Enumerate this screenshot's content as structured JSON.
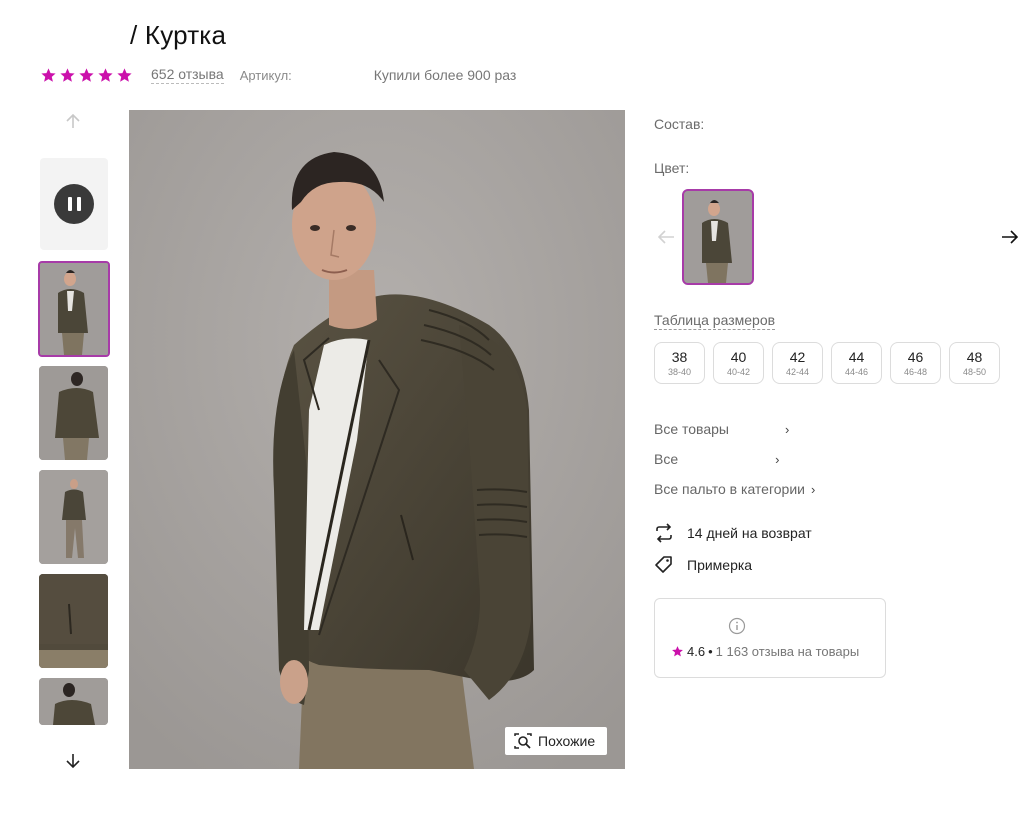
{
  "product": {
    "title": "/ Куртка",
    "reviews_link": "652 отзыва",
    "article_label": "Артикул:",
    "bought_text": "Купили более 900 раз",
    "rating_stars": 5,
    "accent_color": "#cb11ab"
  },
  "gallery": {
    "similar_button": "Похожие",
    "thumbnail_count": 5,
    "active_thumbnail": 1
  },
  "details": {
    "composition_label": "Состав:",
    "color_label": "Цвет:",
    "size_table_link": "Таблица размеров",
    "sizes": [
      {
        "size": "38",
        "range": "38-40"
      },
      {
        "size": "40",
        "range": "40-42"
      },
      {
        "size": "42",
        "range": "42-44"
      },
      {
        "size": "44",
        "range": "44-46"
      },
      {
        "size": "46",
        "range": "46-48"
      },
      {
        "size": "48",
        "range": "48-50"
      }
    ]
  },
  "category_links": [
    {
      "label": "Все товары"
    },
    {
      "label": "Все"
    },
    {
      "label": "Все пальто в категории"
    }
  ],
  "features": {
    "return_text": "14 дней на возврат",
    "fitting_text": "Примерка"
  },
  "store": {
    "rating": "4.6",
    "separator": "•",
    "reviews_text": "1 163 отзыва на товары"
  }
}
